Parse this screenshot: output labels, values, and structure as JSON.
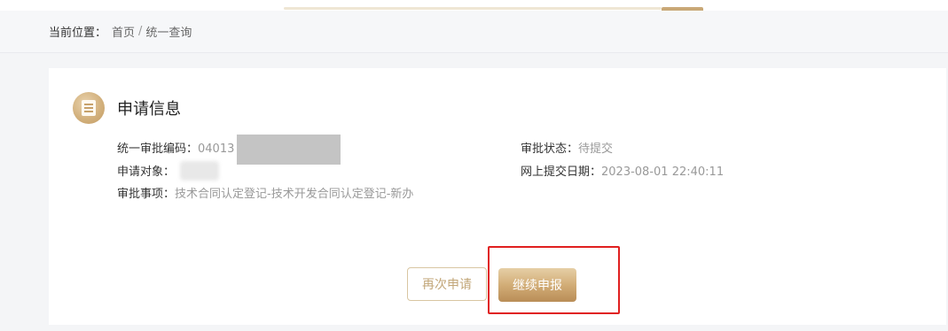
{
  "breadcrumb": {
    "label": "当前位置：",
    "home": "首页",
    "separator": "/",
    "current": "统一查询"
  },
  "section": {
    "title": "申请信息",
    "icon": "document-list-icon"
  },
  "fields": {
    "code": {
      "label": "统一审批编码：",
      "value": "04013"
    },
    "target": {
      "label": "申请对象：",
      "value": ""
    },
    "matter": {
      "label": "审批事项：",
      "value": "技术合同认定登记-技术开发合同认定登记-新办"
    },
    "status": {
      "label": "审批状态：",
      "value": "待提交"
    },
    "submit_date": {
      "label": "网上提交日期：",
      "value": "2023-08-01 22:40:11"
    }
  },
  "actions": {
    "reapply": "再次申请",
    "continue": "继续申报"
  },
  "colors": {
    "accent_gold": "#c9a877",
    "highlight_red": "#e02020"
  }
}
